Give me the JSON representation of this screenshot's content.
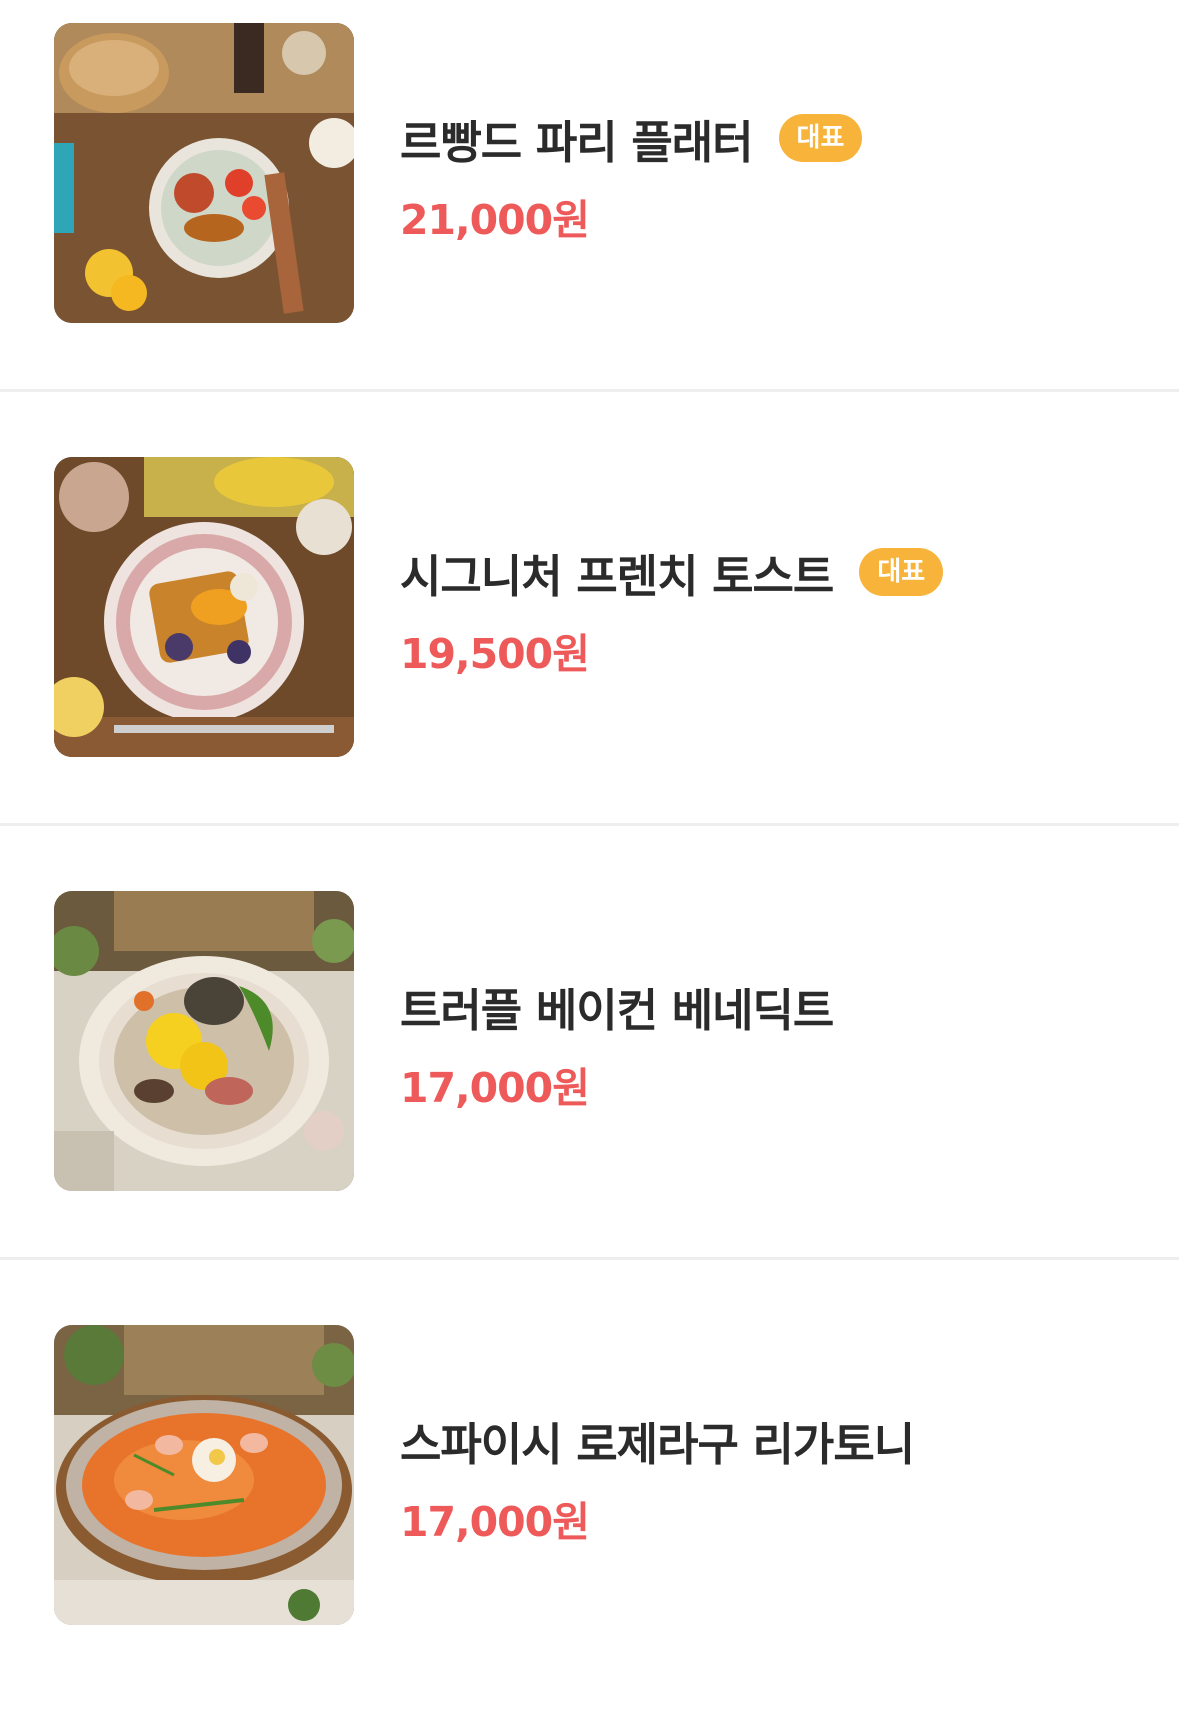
{
  "menu": {
    "items": [
      {
        "name": "르빵드 파리 플래터",
        "badge": "대표",
        "price": "21,000원",
        "image": "brunch-platter-photo"
      },
      {
        "name": "시그니처 프렌치 토스트",
        "badge": "대표",
        "price": "19,500원",
        "image": "french-toast-photo"
      },
      {
        "name": "트러플 베이컨 베네딕트",
        "price": "17,000원",
        "image": "eggs-benedict-photo"
      },
      {
        "name": "스파이시 로제라구 리가토니",
        "price": "17,000원",
        "image": "rigatoni-photo"
      }
    ]
  },
  "colors": {
    "price": "#ee5a5a",
    "badge_bg": "#f7b33a",
    "name_text": "#2b2b2b",
    "divider": "#eeeeee"
  }
}
